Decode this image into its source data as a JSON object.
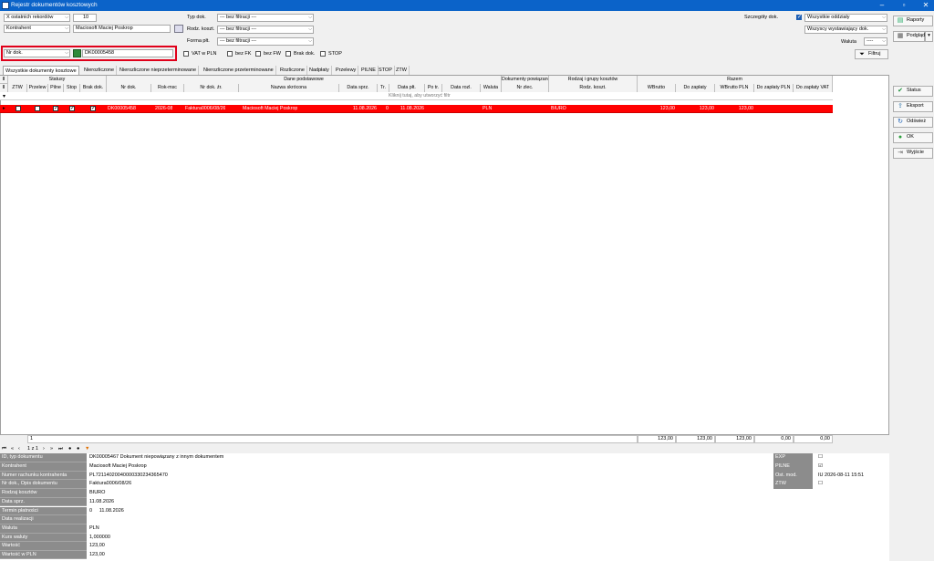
{
  "window": {
    "title": "Rejestr dokumentów kosztowych"
  },
  "filters": {
    "records_combo": "X ostatnich rekordów",
    "records_count": "10",
    "party_combo": "Kontrahent",
    "party_value": "Maciosoft Maciej Poskrop",
    "doc_type_label": "Typ dok.",
    "doc_type_value": "--- bez filtracji ---",
    "cost_kind_label": "Rodz. koszt.",
    "cost_kind_value": "--- bez filtracji ---",
    "payment_label": "Forma płt.",
    "payment_value": "--- bez filtracji ---",
    "details_label": "Szczegóły dok.",
    "branches_value": "Wszystkie oddziały",
    "issuers_value": "Wszyscy wystawiający dok.",
    "currency_label": "Waluta",
    "currency_value": "----",
    "search_field_combo": "Nr dok.",
    "search_value": "DK00005458",
    "vat_pln": "VAT w PLN",
    "no_fk": "bez FK",
    "no_fw": "bez FW",
    "brak_dok": "Brak dok.",
    "stop": "STOP"
  },
  "buttons": {
    "reports": "Raporty",
    "preview": "Podgląd",
    "filter": "Filtruj",
    "status": "Status",
    "export": "Eksport",
    "refresh": "Odśwież",
    "ok": "OK",
    "exit": "Wyjście"
  },
  "tabs": [
    "Wszystkie dokumenty kosztowe",
    "Nierozliczone",
    "Nierozliczone nieprzeterminowane",
    "Nierozliczone przeterminowane",
    "Rozliczone",
    "Nadpłaty",
    "Przelewy",
    "PILNE",
    "STOP",
    "ZTW"
  ],
  "grid": {
    "group_headers": {
      "statusy": "Statusy",
      "dane": "Dane podstawowe",
      "powiazane": "Dokumenty powiązane",
      "rodzaje": "Rodzaj i grupy kosztów",
      "razem": "Razem"
    },
    "columns": [
      "ZTW",
      "Przelew",
      "Pilne",
      "Stop",
      "Brak dok.",
      "Nr dok.",
      "Rok-msc",
      "Nr dok. źr.",
      "Nazwa skrócona",
      "Data sprz.",
      "Tr.",
      "Data płt.",
      "Po tr.",
      "Data rozl.",
      "Waluta",
      "Nr zlec.",
      "Rodz. koszt.",
      "WBrutto",
      "Do zapłaty",
      "WBrutto PLN",
      "Do zapłaty PLN",
      "Do zapłaty VAT"
    ],
    "new_row_hint": "Kliknij tutaj, aby utworzyć filtr",
    "row": {
      "nr_dok": "DK00005458",
      "rok_msc": "2026-08",
      "nr_zr": "Faktura0006/08/26",
      "nazwa": "Maciosoft Maciej Poskrop",
      "data_sprz": "11.08.2026",
      "tr": "0",
      "data_plt": "11.08.2026",
      "po_tr": "",
      "waluta": "PLN",
      "rodz": "BIURO",
      "wbrutto": "123,00",
      "do_zaplaty": "123,00",
      "wbrutto_pln": "123,00"
    },
    "summary": {
      "count": "1",
      "wbrutto": "123,00",
      "do_zaplaty": "123,00",
      "wbrutto_pln": "123,00",
      "do_zaplaty_pln": "0,00",
      "do_zaplaty_vat": "0,00"
    },
    "pager": "1 z 1"
  },
  "details": {
    "left": [
      {
        "label": "ID, typ dokumentu",
        "value": "DK00005467  Dokument niepowiązany z innym dokumentem"
      },
      {
        "label": "Kontrahent",
        "value": "Maciosoft Maciej Poskrop"
      },
      {
        "label": "Numer rachunku kontrahenta",
        "value": "PL72114020040000330234365470"
      },
      {
        "label": "Nr dok., Opis dokumentu",
        "value": "Faktura0006/08/26"
      },
      {
        "label": "Rodzaj kosztów",
        "value": "BIURO"
      },
      {
        "label": "Data sprz.",
        "value": "11.08.2026"
      },
      {
        "label": "Termin płatności",
        "value": "0     11.08.2026"
      },
      {
        "label": "Data realizacji",
        "value": ""
      },
      {
        "label": "Waluta",
        "value": "PLN"
      },
      {
        "label": "Kurs waluty",
        "value": "1,000000"
      },
      {
        "label": "Wartość",
        "value": "123,00"
      },
      {
        "label": "Wartość w PLN",
        "value": "123,00"
      }
    ],
    "right": [
      {
        "label": "EXP",
        "value": "☐"
      },
      {
        "label": "PILNE",
        "value": "☑"
      },
      {
        "label": "Ost. mod.",
        "value": "IU 2026-08-11 15:51"
      },
      {
        "label": "ZTW",
        "value": "☐"
      }
    ]
  }
}
